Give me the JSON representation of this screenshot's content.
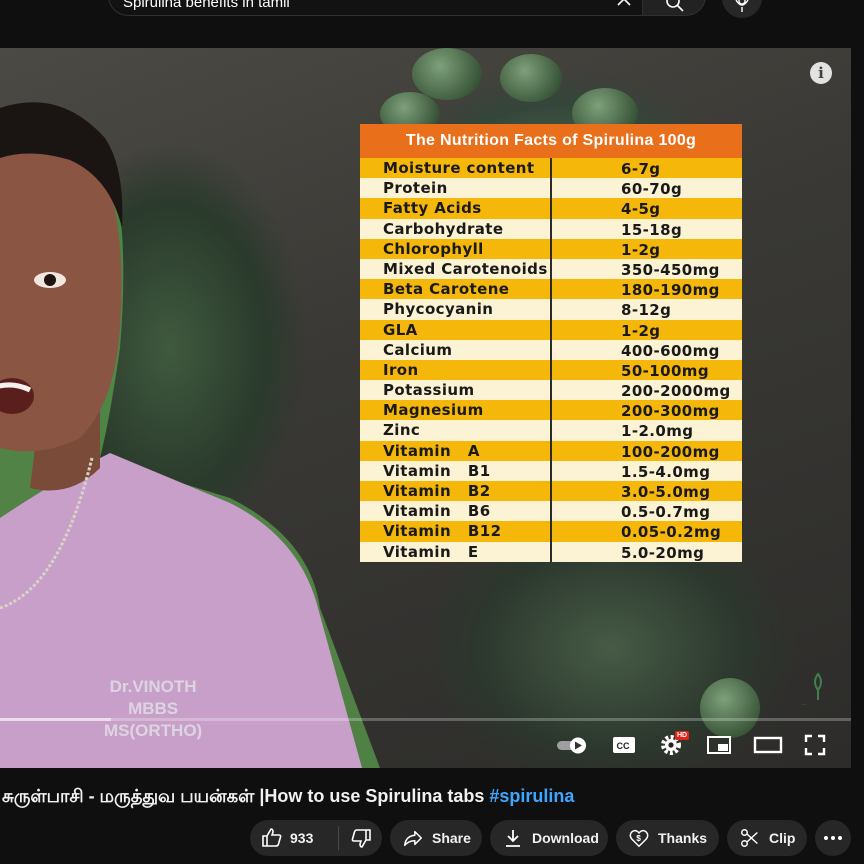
{
  "search": {
    "query": "Spirulina benefits in tamil"
  },
  "player": {
    "watermark": [
      "Dr.VINOTH",
      "MBBS",
      "MS(ORTHO)"
    ],
    "progress_fraction": 0.13,
    "hd_label": "HD"
  },
  "nutrition_table": {
    "title": "The Nutrition Facts of Spirulina 100g",
    "rows": [
      {
        "name": "Moisture content",
        "value": "6-7g"
      },
      {
        "name": "Protein",
        "value": "60-70g"
      },
      {
        "name": "Fatty Acids",
        "value": "4-5g"
      },
      {
        "name": "Carbohydrate",
        "value": "15-18g"
      },
      {
        "name": "Chlorophyll",
        "value": "1-2g"
      },
      {
        "name": "Mixed Carotenoids",
        "value": "350-450mg"
      },
      {
        "name": "Beta Carotene",
        "value": "180-190mg"
      },
      {
        "name": "Phycocyanin",
        "value": "8-12g"
      },
      {
        "name": "GLA",
        "value": "1-2g"
      },
      {
        "name": "Calcium",
        "value": "400-600mg"
      },
      {
        "name": "Iron",
        "value": "50-100mg"
      },
      {
        "name": "Potassium",
        "value": "200-2000mg"
      },
      {
        "name": "Magnesium",
        "value": "200-300mg"
      },
      {
        "name": "Zinc",
        "value": "1-2.0mg"
      },
      {
        "name": "Vitamin   A",
        "value": "100-200mg"
      },
      {
        "name": "Vitamin   B1",
        "value": "1.5-4.0mg"
      },
      {
        "name": "Vitamin   B2",
        "value": "3.0-5.0mg"
      },
      {
        "name": "Vitamin   B6",
        "value": "0.5-0.7mg"
      },
      {
        "name": "Vitamin   B12",
        "value": "0.05-0.2mg"
      },
      {
        "name": "Vitamin   E",
        "value": "5.0-20mg"
      }
    ]
  },
  "video": {
    "title": "சுருள்பாசி - மருத்துவ பயன்கள் |How to use Spirulina tabs ",
    "hashtag": "#spirulina"
  },
  "actions": {
    "like_count": "933",
    "share": "Share",
    "download": "Download",
    "thanks": "Thanks",
    "clip": "Clip"
  },
  "colors": {
    "hashtag": "#3ea6ff",
    "table_title_bg": "#e96f1a",
    "table_row_yellow": "#f6b70b"
  }
}
